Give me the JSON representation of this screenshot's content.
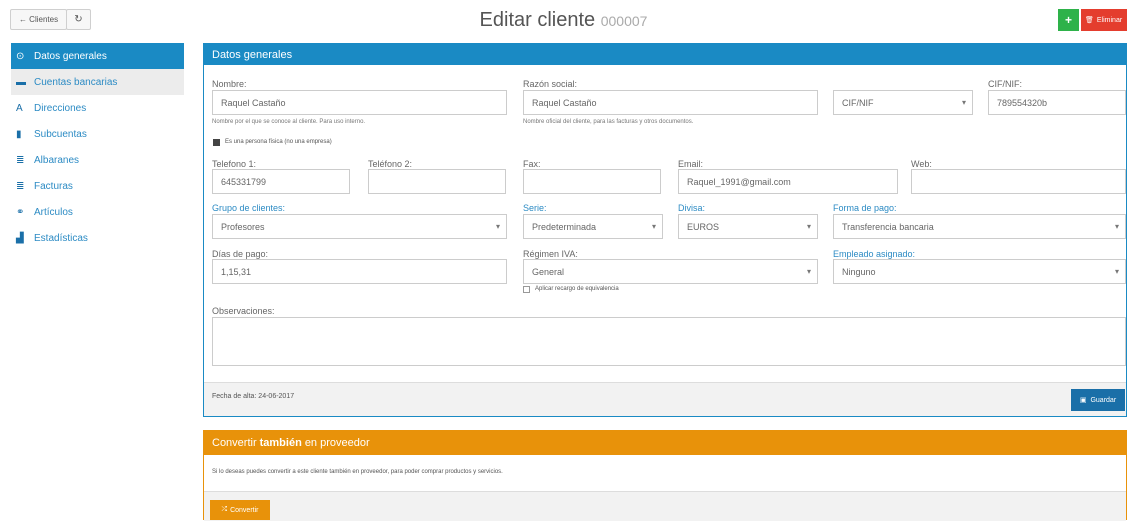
{
  "topbar": {
    "back_label": "← Clientes",
    "refresh_icon": "↻",
    "title": "Editar cliente",
    "code": "000007",
    "new_label": "+",
    "delete_label": "Eliminar",
    "delete_icon": "🗑"
  },
  "sidebar": {
    "items": [
      {
        "label": "Datos generales",
        "icon": "⊙"
      },
      {
        "label": "Cuentas bancarias",
        "icon": "▬"
      },
      {
        "label": "Direcciones",
        "icon": "A"
      },
      {
        "label": "Subcuentas",
        "icon": "▮"
      },
      {
        "label": "Albaranes",
        "icon": "≣"
      },
      {
        "label": "Facturas",
        "icon": "≣"
      },
      {
        "label": "Artículos",
        "icon": "⚭"
      },
      {
        "label": "Estadísticas",
        "icon": "▟"
      }
    ]
  },
  "form": {
    "header": "Datos generales",
    "nombre_label": "Nombre:",
    "nombre_value": "Raquel Castaño",
    "nombre_help": "Nombre por el que se conoce al cliente. Para uso interno.",
    "razon_label": "Razón social:",
    "razon_value": "Raquel Castaño",
    "razon_help": "Nombre oficial del cliente, para las facturas y otros documentos.",
    "tipoid_value": "CIF/NIF",
    "cif_label": "CIF/NIF:",
    "cif_value": "789554320b",
    "persona_label": "Es una persona física (no una empresa)",
    "tel1_label": "Telefono 1:",
    "tel1_value": "645331799",
    "tel2_label": "Teléfono 2:",
    "tel2_value": "",
    "fax_label": "Fax:",
    "fax_value": "",
    "email_label": "Email:",
    "email_value": "Raquel_1991@gmail.com",
    "web_label": "Web:",
    "web_value": "",
    "grupo_label": "Grupo de clientes:",
    "grupo_value": "Profesores",
    "serie_label": "Serie:",
    "serie_value": "Predeterminada",
    "divisa_label": "Divisa:",
    "divisa_value": "EUROS",
    "formapago_label": "Forma de pago:",
    "formapago_value": "Transferencia bancaria",
    "dias_label": "Días de pago:",
    "dias_value": "1,15,31",
    "regimen_label": "Régimen IVA:",
    "regimen_value": "General",
    "recargo_label": "Aplicar recargo de equivalencia",
    "empleado_label": "Empleado asignado:",
    "empleado_value": "Ninguno",
    "observaciones_label": "Observaciones:",
    "fecha_alta": "Fecha de alta: 24-06-2017",
    "save_label": "Guardar",
    "save_icon": "▣"
  },
  "convert": {
    "header_pre": "Convertir",
    "header_bold": "también",
    "header_post": "en proveedor",
    "description": "Si lo deseas puedes convertir a este cliente también en proveedor, para poder comprar productos y servicios.",
    "button_label": "Convertir",
    "button_icon": "⤮"
  },
  "colors": {
    "primary": "#1a8ac4",
    "success": "#2eb24a",
    "danger": "#e43d2e",
    "warning": "#e8920a"
  }
}
